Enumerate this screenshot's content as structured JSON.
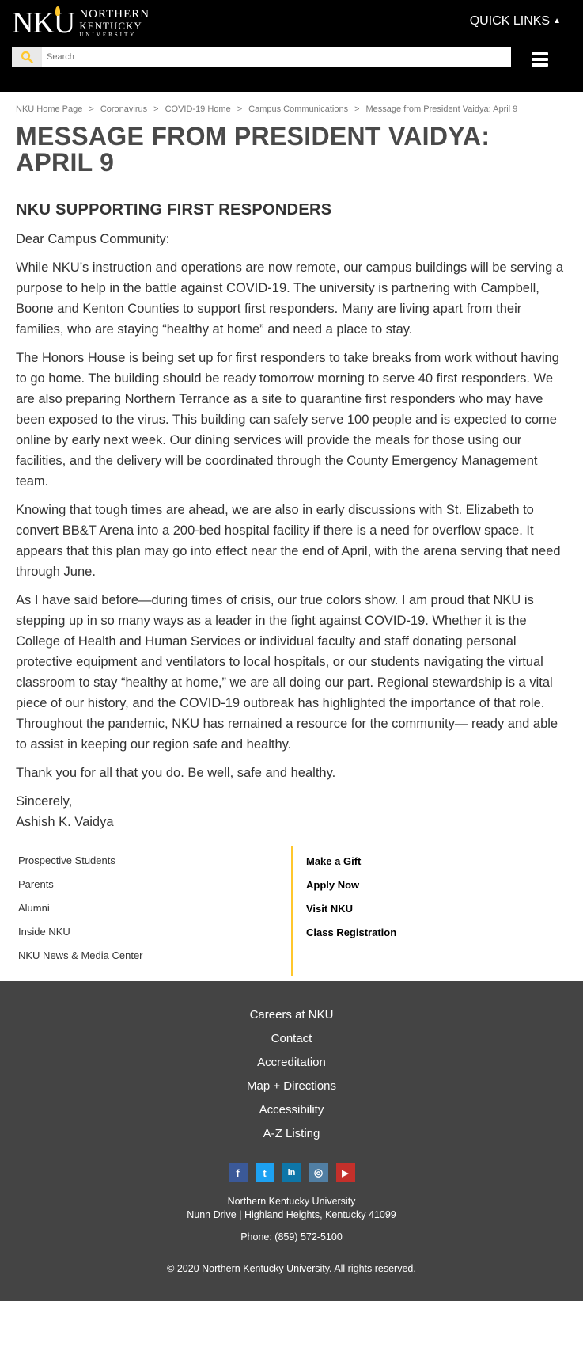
{
  "header": {
    "logo_mark": "NKU",
    "logo_line1": "NORTHERN",
    "logo_line2": "KENTUCKY",
    "logo_line3": "UNIVERSITY",
    "quick_links": "QUICK LINKS",
    "search_placeholder": "Search"
  },
  "breadcrumb": [
    "NKU Home Page",
    "Coronavirus",
    "COVID-19 Home",
    "Campus Communications",
    "Message from President Vaidya: April 9"
  ],
  "breadcrumb_sep": ">",
  "main": {
    "title": "MESSAGE FROM PRESIDENT VAIDYA: APRIL 9",
    "subtitle": "NKU SUPPORTING FIRST RESPONDERS",
    "greeting": "Dear Campus Community:",
    "paragraphs": [
      "While NKU’s instruction and operations are now remote, our campus buildings will be serving a purpose to help in the battle against COVID-19. The university is partnering with Campbell, Boone and Kenton Counties to support first responders. Many are living apart from their families, who are staying “healthy at home” and need a place to stay.",
      "The Honors House is being set up for first responders to take breaks from work without having to go home. The building should be ready tomorrow morning to serve 40 first responders. We are also preparing Northern Terrance as a site to quarantine first responders who may have been exposed to the virus. This building can safely serve 100 people and is expected to come online by early next week. Our dining services will provide the meals for those using our facilities, and the delivery will be coordinated through the County Emergency Management team.",
      "Knowing that tough times are ahead, we are also in early discussions with St. Elizabeth to convert BB&T Arena into a 200-bed hospital facility if there is a need for overflow space. It appears that this plan may go into effect near the end of April, with the arena serving that need through June.",
      "As I have said before—during times of crisis, our true colors show. I am proud that NKU is stepping up in so many ways as a leader in the fight against COVID-19. Whether it is the College of Health and Human Services or individual faculty and staff donating personal protective equipment and ventilators to local hospitals, or our students navigating the virtual classroom to stay “healthy at home,” we are all doing our part. Regional stewardship is a vital piece of our history, and the COVID-19 outbreak has highlighted the importance of that role. Throughout the pandemic, NKU has remained a resource for the community— ready and able to assist in keeping our region safe and healthy.",
      "Thank you for all that you do. Be well, safe and healthy."
    ],
    "closing": "Sincerely,",
    "signature": "Ashish K. Vaidya"
  },
  "audience_links": [
    "Prospective Students",
    "Parents",
    "Alumni",
    "Inside NKU",
    "NKU News & Media Center"
  ],
  "action_links": [
    "Make a Gift",
    "Apply Now",
    "Visit NKU",
    "Class Registration"
  ],
  "footer": {
    "links": [
      "Careers at NKU",
      "Contact",
      "Accreditation",
      "Map + Directions",
      "Accessibility",
      "A-Z Listing"
    ],
    "social": [
      {
        "icon": "facebook-icon",
        "glyph": "f",
        "color": "#3b5998"
      },
      {
        "icon": "twitter-icon",
        "glyph": "t",
        "color": "#1da1f2"
      },
      {
        "icon": "linkedin-icon",
        "glyph": "in",
        "color": "#0e76a8"
      },
      {
        "icon": "instagram-icon",
        "glyph": "◎",
        "color": "#517fa4"
      },
      {
        "icon": "youtube-icon",
        "glyph": "▶",
        "color": "#c4302b"
      }
    ],
    "address_line1": "Northern Kentucky University",
    "address_line2": "Nunn Drive | Highland Heights, Kentucky 41099",
    "phone": "Phone: (859) 572-5100",
    "copyright": "© 2020 Northern Kentucky University. All rights reserved."
  },
  "colors": {
    "accent": "#ffc72c",
    "header_bg": "#000000",
    "footer_bg": "#444444"
  }
}
